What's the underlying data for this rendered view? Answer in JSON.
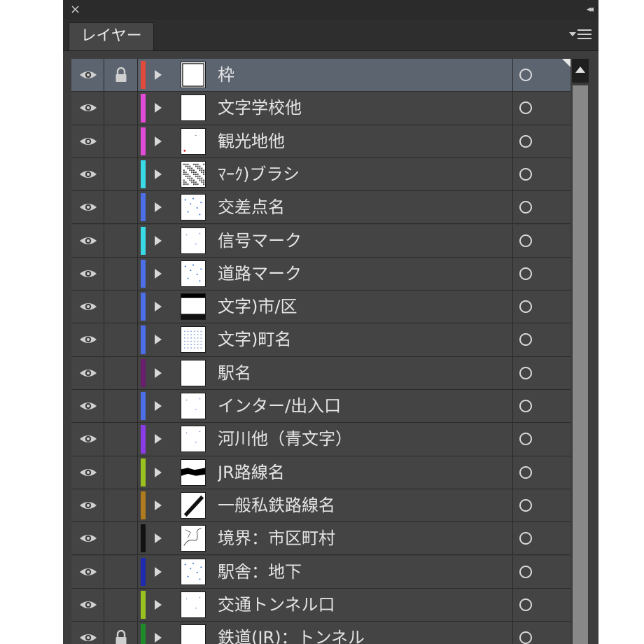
{
  "panel": {
    "close_glyph": "×",
    "collapse_glyph": "◂◂",
    "tab_label": "レイヤー"
  },
  "layers": [
    {
      "name": "枠",
      "color": "#e04a3c",
      "locked": true,
      "selected": true,
      "thumb": "frame"
    },
    {
      "name": "文字学校他",
      "color": "#e24bd6",
      "locked": false,
      "selected": false,
      "thumb": "blank"
    },
    {
      "name": "観光地他",
      "color": "#e24bd6",
      "locked": false,
      "selected": false,
      "thumb": "sparse-red"
    },
    {
      "name": "ﾏｰｸ)ブラシ",
      "color": "#39d9e6",
      "locked": false,
      "selected": false,
      "thumb": "dense"
    },
    {
      "name": "交差点名",
      "color": "#4c6ee6",
      "locked": false,
      "selected": false,
      "thumb": "blue-dots"
    },
    {
      "name": "信号マーク",
      "color": "#39d9e6",
      "locked": false,
      "selected": false,
      "thumb": "few-dots"
    },
    {
      "name": "道路マーク",
      "color": "#4c6ee6",
      "locked": false,
      "selected": false,
      "thumb": "blue-dots"
    },
    {
      "name": "文字)市/区",
      "color": "#4c6ee6",
      "locked": false,
      "selected": false,
      "thumb": "black-top"
    },
    {
      "name": "文字)町名",
      "color": "#4c6ee6",
      "locked": false,
      "selected": false,
      "thumb": "blue-grid"
    },
    {
      "name": "駅名",
      "color": "#6a1e6e",
      "locked": false,
      "selected": false,
      "thumb": "blank"
    },
    {
      "name": "インター/出入口",
      "color": "#4c6ee6",
      "locked": false,
      "selected": false,
      "thumb": "few-dots"
    },
    {
      "name": "河川他（青文字）",
      "color": "#8a3ce6",
      "locked": false,
      "selected": false,
      "thumb": "few-dots"
    },
    {
      "name": "JR路線名",
      "color": "#9ac21e",
      "locked": false,
      "selected": false,
      "thumb": "black-band"
    },
    {
      "name": "一般私鉄路線名",
      "color": "#b07a1e",
      "locked": false,
      "selected": false,
      "thumb": "diagonal"
    },
    {
      "name": "境界：市区町村",
      "color": "#111111",
      "locked": false,
      "selected": false,
      "thumb": "outline"
    },
    {
      "name": "駅舎：地下",
      "color": "#1e2ab0",
      "locked": false,
      "selected": false,
      "thumb": "blue-dots"
    },
    {
      "name": "交通トンネル口",
      "color": "#9ac21e",
      "locked": false,
      "selected": false,
      "thumb": "few-dots"
    },
    {
      "name": "鉄道(JR)：トンネル",
      "color": "#1e8a2a",
      "locked": true,
      "selected": false,
      "thumb": "blank"
    }
  ],
  "icons": {
    "visibility": "eye-icon",
    "lock": "lock-icon",
    "expand": "expand-arrow-icon",
    "target": "target-circle-icon",
    "panel_menu": "panel-menu-icon"
  }
}
